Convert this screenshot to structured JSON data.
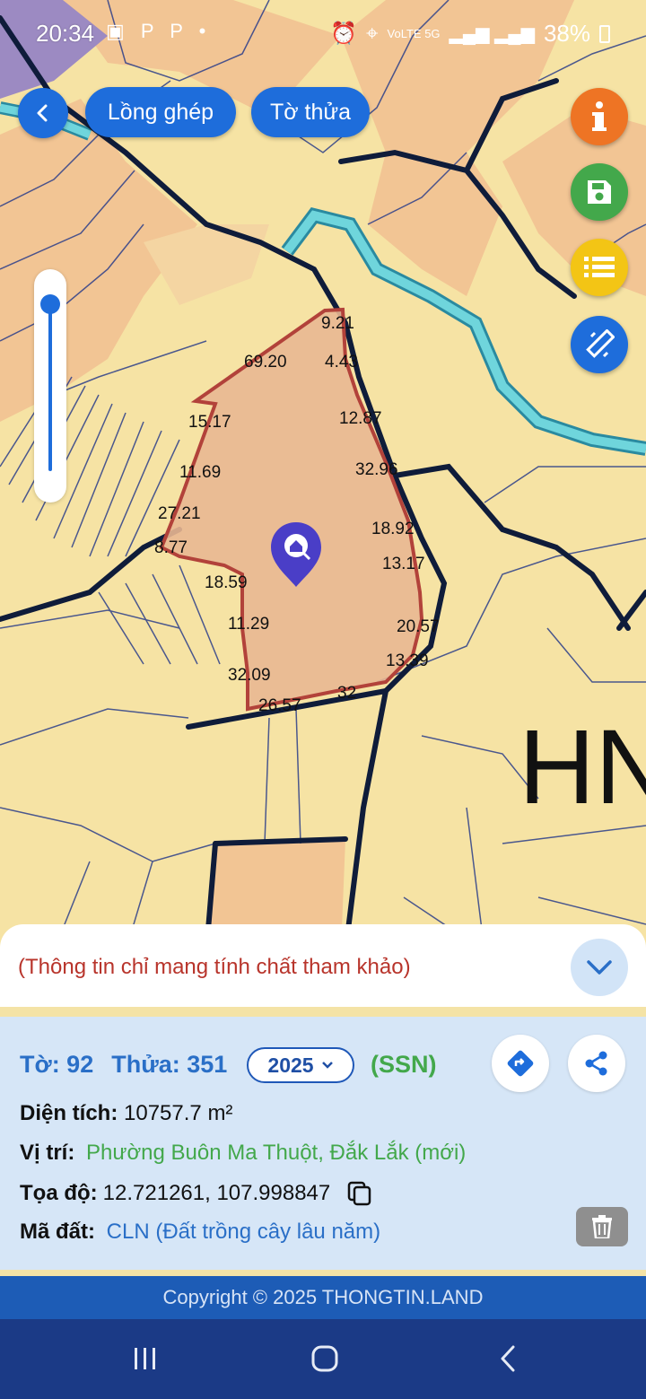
{
  "status_bar": {
    "time": "20:34",
    "left_icons": "▣ P P •",
    "network": "VoLTE 5G",
    "battery": "38%"
  },
  "toolbar": {
    "back_icon": "chevron-left-icon",
    "layer_label": "Lồng ghép",
    "parcel_label": "Tờ thửa"
  },
  "side_buttons": {
    "info_icon": "info-icon",
    "save_icon": "save-icon",
    "list_icon": "list-icon",
    "measure_icon": "measure-icon"
  },
  "map": {
    "district_label": "HN",
    "edge_labels": [
      "9.21",
      "69.20",
      "4.43",
      "15.17",
      "12.87",
      "11.69",
      "32.96",
      "27.21",
      "18.92",
      "8.77",
      "13.17",
      "18.59",
      "11.29",
      "20.57",
      "13.39",
      "32.09",
      "32",
      "26.57"
    ],
    "colors": {
      "land_yellow": "#f6e3a4",
      "land_orange": "#f2c594",
      "parcel_fill": "#e9b792",
      "parcel_border": "#b2423a",
      "river": "#6fd5dc",
      "road": "#0f1c3a",
      "purple_zone": "#9c8ac2",
      "marker": "#4a3ec7"
    }
  },
  "notice": {
    "text": "(Thông tin chỉ mang tính chất tham khảo)"
  },
  "info": {
    "sheet_label": "Tờ: 92",
    "parcel_label": "Thửa: 351",
    "year": "2025",
    "ssn": "(SSN)",
    "area_label": "Diện tích:",
    "area_value": "10757.7 m²",
    "location_label": "Vị trí:",
    "location_value": "Phường Buôn Ma Thuột, Đắk Lắk (mới)",
    "coords_label": "Tọa độ:",
    "coords_value": "12.721261, 107.998847",
    "landcode_label": "Mã đất:",
    "landcode_value": "CLN (Đất trồng cây lâu năm)"
  },
  "footer": {
    "copyright": "Copyright © 2025 THONGTIN.LAND"
  },
  "nav": {
    "recent_icon": "recent-apps-icon",
    "home_icon": "home-icon",
    "back_icon": "back-icon"
  }
}
